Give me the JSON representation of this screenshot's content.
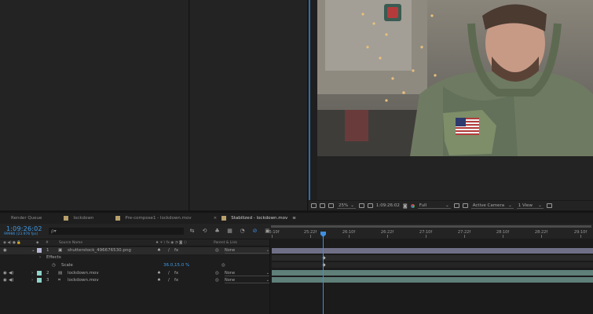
{
  "tabs": [
    {
      "label": "Render Queue",
      "swatch": "",
      "active": false
    },
    {
      "label": "lockdown",
      "swatch": "#b8a06a",
      "active": false
    },
    {
      "label": "Pre-compose1 - lockdown.mov",
      "swatch": "#b8a06a",
      "active": false
    },
    {
      "label": "Stabilized - lockdown.mov",
      "swatch": "#b8a06a",
      "active": true
    }
  ],
  "tab_close": "×",
  "tab_menu": "≡",
  "timeline": {
    "timecode": "1:09:26:02",
    "fps_line": "99986 (23.976 fps)",
    "search_placeholder": "ρ▾"
  },
  "ruler_labels": [
    "5:10f",
    "25:22f",
    "26:10f",
    "26:22f",
    "27:10f",
    "27:22f",
    "28:10f",
    "28:22f",
    "29:10f"
  ],
  "columns": {
    "num": "#",
    "source_name": "Source Name",
    "switches": "♠ ✶ \\ fx ◉ ◔ ◙ ⬡",
    "parent": "Parent & Link"
  },
  "layers": [
    {
      "num": "1",
      "name": "shutterstock_496676530.png",
      "color": "#b7b7d6",
      "parent": "None"
    },
    {
      "num": "2",
      "name": "lockdown.mov",
      "color": "#8fd3c9",
      "parent": "None"
    },
    {
      "num": "3",
      "name": "lockdown.mov",
      "color": "#8fd3c9",
      "parent": "None"
    }
  ],
  "effects_label": "Effects",
  "scale": {
    "label": "Scale",
    "value": "36.0,15.0 %"
  },
  "viewer": {
    "zoom": "25%",
    "time": "1:09:26:02",
    "resolution": "Full",
    "camera": "Active Camera",
    "view": "1 View"
  },
  "colors": {
    "accent": "#3f9ae6",
    "playhead": "#3f8fe0",
    "layer1_bar": "#6f6f86",
    "layer2_bar": "#5f7f79",
    "layer3_bar": "#5f7f79"
  }
}
